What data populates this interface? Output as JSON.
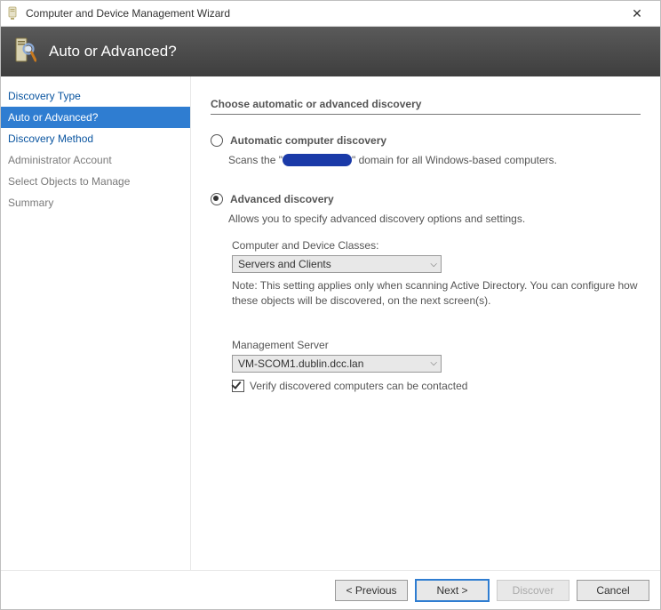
{
  "window": {
    "title": "Computer and Device Management Wizard"
  },
  "banner": {
    "title": "Auto or Advanced?"
  },
  "sidebar": {
    "items": [
      {
        "label": "Discovery Type",
        "state": "link"
      },
      {
        "label": "Auto or Advanced?",
        "state": "selected"
      },
      {
        "label": "Discovery Method",
        "state": "link"
      },
      {
        "label": "Administrator Account",
        "state": "disabled"
      },
      {
        "label": "Select Objects to Manage",
        "state": "disabled"
      },
      {
        "label": "Summary",
        "state": "disabled"
      }
    ]
  },
  "main": {
    "heading": "Choose automatic or advanced discovery",
    "auto": {
      "label": "Automatic computer discovery",
      "desc_pre": "Scans the \"",
      "desc_post": "\" domain for all Windows-based computers."
    },
    "advanced": {
      "label": "Advanced discovery",
      "desc": "Allows you to specify advanced discovery options and settings.",
      "classes_label": "Computer and Device Classes:",
      "classes_value": "Servers and Clients",
      "note": "Note: This setting applies only when scanning Active Directory.  You can configure how these objects will be discovered, on the next screen(s).",
      "mgmt_label": "Management Server",
      "mgmt_value": "VM-SCOM1.dublin.dcc.lan",
      "verify_label": "Verify discovered computers can be contacted"
    }
  },
  "footer": {
    "previous": "< Previous",
    "next": "Next >",
    "discover": "Discover",
    "cancel": "Cancel"
  }
}
